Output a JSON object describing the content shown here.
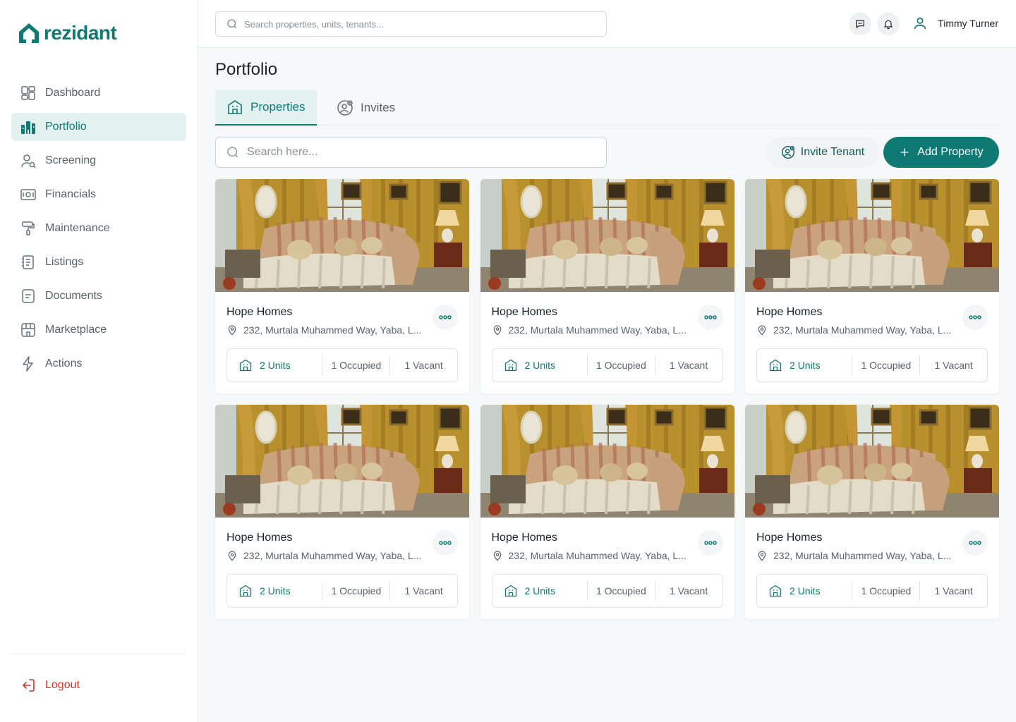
{
  "app": {
    "logo_text": "rezidant",
    "accent": "#0e7a73",
    "danger": "#d6332b"
  },
  "sidebar": {
    "items": [
      {
        "label": "Dashboard",
        "icon": "dashboard-icon"
      },
      {
        "label": "Portfolio",
        "icon": "portfolio-icon",
        "active": true
      },
      {
        "label": "Screening",
        "icon": "screening-icon"
      },
      {
        "label": "Financials",
        "icon": "financials-icon"
      },
      {
        "label": "Maintenance",
        "icon": "maintenance-icon"
      },
      {
        "label": "Listings",
        "icon": "listings-icon"
      },
      {
        "label": "Documents",
        "icon": "documents-icon"
      },
      {
        "label": "Marketplace",
        "icon": "marketplace-icon"
      },
      {
        "label": "Actions",
        "icon": "actions-icon"
      }
    ],
    "logout_label": "Logout"
  },
  "topbar": {
    "search_placeholder": "Search properties, units, tenants...",
    "user_name": "Timmy Turner"
  },
  "main": {
    "title": "Portfolio",
    "tabs": [
      {
        "label": "Properties",
        "active": true
      },
      {
        "label": "Invites"
      }
    ],
    "search_placeholder": "Search here...",
    "invite_label": "Invite Tenant",
    "add_label": "Add Property"
  },
  "cards": [
    {
      "name": "Hope Homes",
      "address": "232, Murtala Muhammed Way, Yaba, L...",
      "units": "2 Units",
      "occupied": "1 Occupied",
      "vacant": "1 Vacant"
    },
    {
      "name": "Hope Homes",
      "address": "232, Murtala Muhammed Way, Yaba, L...",
      "units": "2 Units",
      "occupied": "1 Occupied",
      "vacant": "1 Vacant"
    },
    {
      "name": "Hope Homes",
      "address": "232, Murtala Muhammed Way, Yaba, L...",
      "units": "2 Units",
      "occupied": "1 Occupied",
      "vacant": "1 Vacant"
    },
    {
      "name": "Hope Homes",
      "address": "232, Murtala Muhammed Way, Yaba, L...",
      "units": "2 Units",
      "occupied": "1 Occupied",
      "vacant": "1 Vacant"
    },
    {
      "name": "Hope Homes",
      "address": "232, Murtala Muhammed Way, Yaba, L...",
      "units": "2 Units",
      "occupied": "1 Occupied",
      "vacant": "1 Vacant"
    },
    {
      "name": "Hope Homes",
      "address": "232, Murtala Muhammed Way, Yaba, L...",
      "units": "2 Units",
      "occupied": "1 Occupied",
      "vacant": "1 Vacant"
    }
  ]
}
